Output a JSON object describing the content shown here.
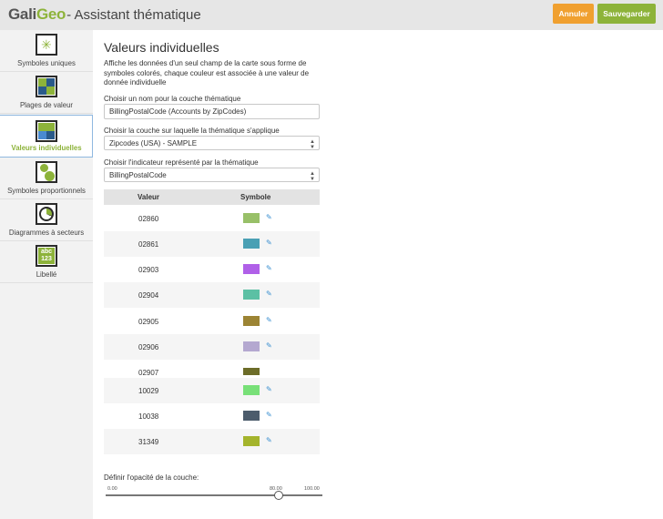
{
  "header": {
    "logo_part1": "Gali",
    "logo_part2": "Geo",
    "title": "- Assistant thématique",
    "cancel_label": "Annuler",
    "save_label": "Sauvegarder",
    "cancel_color": "#f0a030",
    "save_color": "#8db33a"
  },
  "sidebar": {
    "items": [
      {
        "label": "Symboles uniques",
        "icon": "unique-symbols-icon"
      },
      {
        "label": "Plages de valeur",
        "icon": "value-ranges-icon"
      },
      {
        "label": "Valeurs individuelles",
        "icon": "individual-values-icon",
        "active": true
      },
      {
        "label": "Symboles proportionnels",
        "icon": "proportional-symbols-icon"
      },
      {
        "label": "Diagrammes à secteurs",
        "icon": "pie-chart-icon"
      },
      {
        "label": "Libellé",
        "icon": "label-icon",
        "icon_text_1": "abc",
        "icon_text_2": "123"
      }
    ]
  },
  "main": {
    "title": "Valeurs individuelles",
    "description": "Affiche les données d'un seul champ de la carte sous forme de symboles colorés, chaque couleur est associée à une valeur de donnée individuelle",
    "layer_name_label": "Choisir un nom pour la couche thématique",
    "layer_name_value": "BillingPostalCode (Accounts by ZipCodes)",
    "target_layer_label": "Choisir la couche sur laquelle la thématique s'applique",
    "target_layer_value": "Zipcodes (USA) - SAMPLE",
    "indicator_label": "Choisir l'indicateur représenté par la thématique",
    "indicator_value": "BillingPostalCode",
    "table": {
      "col_value": "Valeur",
      "col_symbol": "Symbole",
      "rows": [
        {
          "value": "02860",
          "color": "#98c068"
        },
        {
          "value": "02861",
          "color": "#4aa0b4"
        },
        {
          "value": "02903",
          "color": "#b060e8"
        },
        {
          "value": "02904",
          "color": "#5cc0a4"
        },
        {
          "value": "02905",
          "color": "#9c8434"
        },
        {
          "value": "02906",
          "color": "#b4a8d0"
        },
        {
          "value": "02907",
          "color": "#6c6c28"
        },
        {
          "value": "10029",
          "color": "#78e078"
        },
        {
          "value": "10038",
          "color": "#4c5c6c"
        },
        {
          "value": "31349",
          "color": "#a4b42c"
        }
      ]
    },
    "opacity": {
      "label": "Définir l'opacité de la couche:",
      "min": "0.00",
      "max": "100.00",
      "current": "80.00",
      "value": 80
    }
  }
}
